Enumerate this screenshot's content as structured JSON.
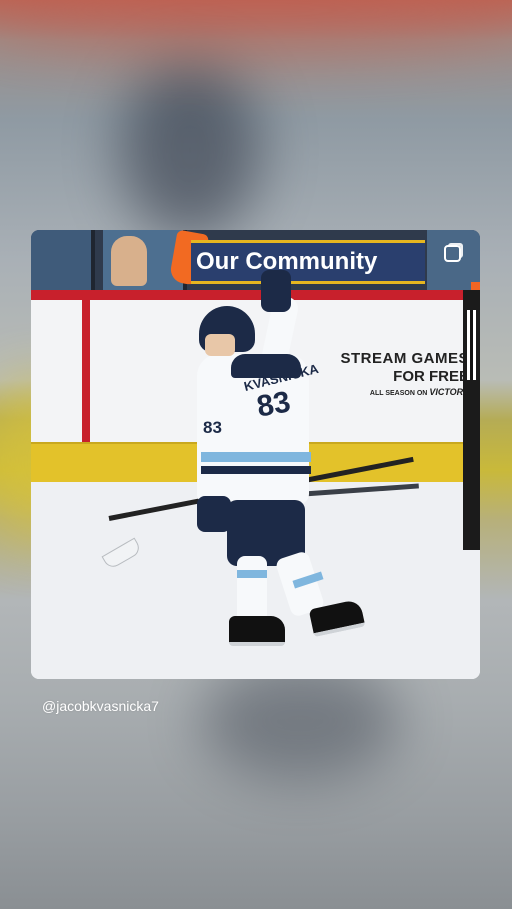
{
  "post": {
    "banner_text": "Our Community",
    "ad": {
      "line1": "STREAM GAMES",
      "line2": "FOR FREE",
      "line3_prefix": "ALL SEASON ON",
      "line3_brand": "VICTORY"
    },
    "jersey": {
      "name": "KVASNICKA",
      "number_back": "83",
      "number_sleeve": "83"
    },
    "multi_icon": "carousel-icon"
  },
  "username": "@jacobkvasnicka7",
  "colors": {
    "navy": "#1c2a47",
    "accent_blue": "#7fb6de",
    "board_red": "#c8202c",
    "kickplate_yellow": "#e3c22a"
  }
}
